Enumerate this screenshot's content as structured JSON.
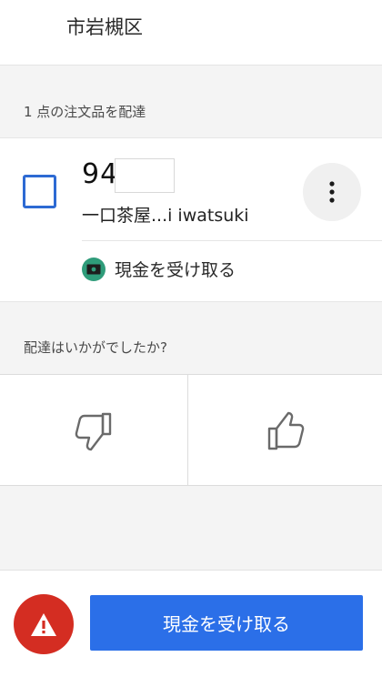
{
  "header": {
    "address_tail": "市岩槻区"
  },
  "order_section": {
    "label": "1 点の注文品を配達",
    "order_number": "94",
    "store_name": "一口茶屋...i iwatsuki",
    "payment_label": "現金を受け取る",
    "icons": {
      "more": "more-vertical-icon",
      "cash": "cash-icon",
      "checkbox": "checkbox-unchecked"
    }
  },
  "rating_section": {
    "question": "配達はいかがでしたか?",
    "icons": {
      "down": "thumbs-down-icon",
      "up": "thumbs-up-icon"
    }
  },
  "footer": {
    "action_label": "現金を受け取る",
    "icons": {
      "alert": "warning-triangle-icon"
    }
  },
  "colors": {
    "accent_blue": "#2b6fe8",
    "checkbox_blue": "#2d6ad3",
    "alert_red": "#d42d22",
    "cash_green": "#2f9c7a"
  }
}
